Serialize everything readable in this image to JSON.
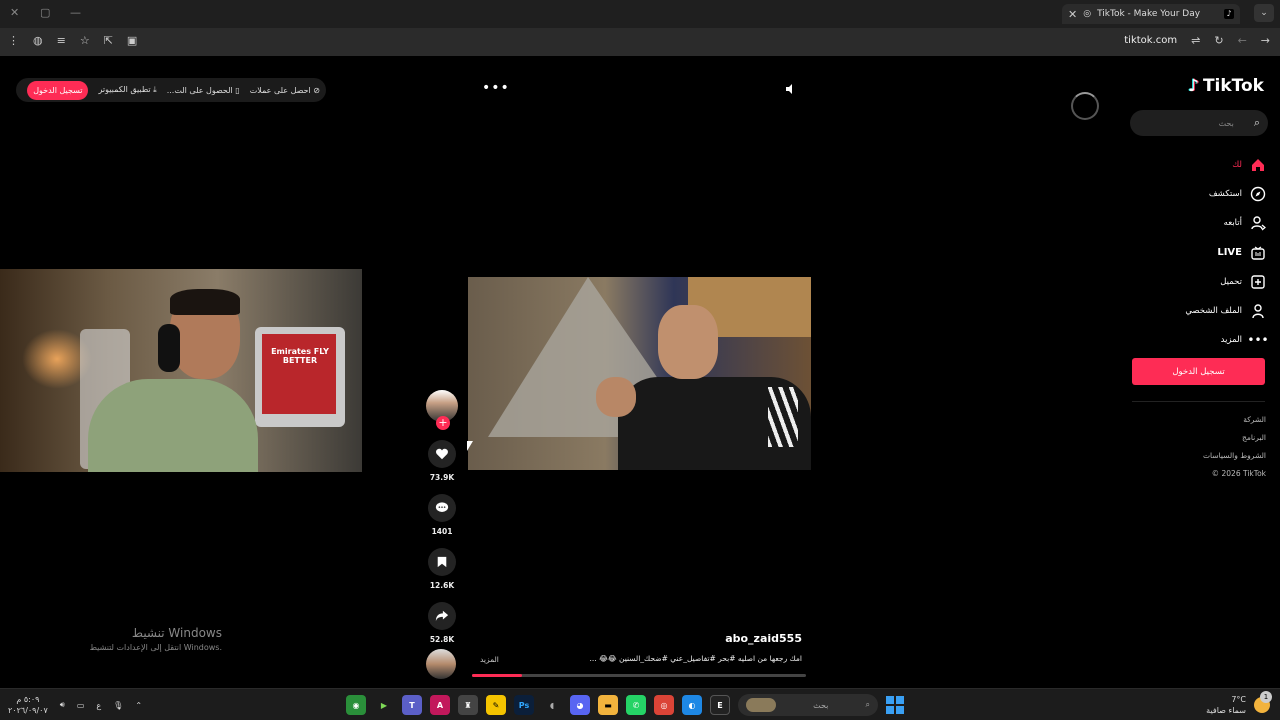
{
  "browser": {
    "tab_title": "TikTok - Make Your Day",
    "url": "tiktok.com"
  },
  "topbar": {
    "coins_label": "احصل على عملات",
    "app_label": "الحصول على الت...",
    "desktop_label": "تطبيق الكمبيوتر",
    "login_label": "تسجيل الدخول"
  },
  "sidebar": {
    "logo_text": "TikTok",
    "search_placeholder": "بحث",
    "items": [
      {
        "label": "لك",
        "icon": "home-icon",
        "active": true
      },
      {
        "label": "استكشف",
        "icon": "compass-icon",
        "active": false
      },
      {
        "label": "أتابعه",
        "icon": "following-icon",
        "active": false
      },
      {
        "label": "LIVE",
        "icon": "live-icon",
        "active": false
      },
      {
        "label": "تحميل",
        "icon": "upload-icon",
        "active": false
      },
      {
        "label": "الملف الشخصي",
        "icon": "profile-icon",
        "active": false
      },
      {
        "label": "المزيد",
        "icon": "more-icon",
        "active": false
      }
    ],
    "login_button": "تسجيل الدخول",
    "footer": [
      "الشركة",
      "البرنامج",
      "الشروط والسياسات",
      "© 2026 TikTok"
    ]
  },
  "video": {
    "author": "abo_zaid555",
    "caption": "امك رجعها من اصليه #بحر #تفاصيل_عني #ضحك_السنين 😂😂 ...",
    "more_label": "المزيد",
    "progress": 0.15,
    "likes": "73.9K",
    "comments": "1401",
    "saves": "12.6K",
    "shares": "52.8K"
  },
  "webcam": {
    "shirt_text": "Emirates FLY BETTER"
  },
  "watermark": {
    "title": "تنشيط Windows",
    "subtitle": "انتقل إلى الإعدادات لتنشيط Windows."
  },
  "taskbar": {
    "time": "٥:٠٩ م",
    "date": "٢٠٢٦/٠٩/٠٧",
    "lang": "ع",
    "search_placeholder": "بحث",
    "weather_temp": "7°C",
    "weather_desc": "سماء صافية",
    "notif_count": "1"
  },
  "colors": {
    "accent": "#fe2c55",
    "background": "#000000"
  }
}
